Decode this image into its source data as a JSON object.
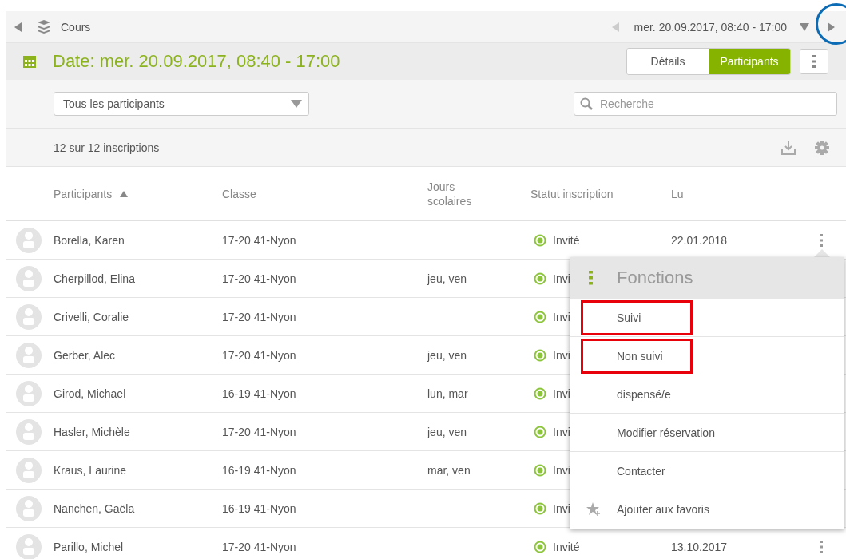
{
  "nav": {
    "breadcrumb": "Cours",
    "date": "mer. 20.09.2017, 08:40 - 17:00",
    "prev_disabled": true,
    "next_highlighted": true
  },
  "header": {
    "title": "Date: mer. 20.09.2017, 08:40 - 17:00",
    "tabs": [
      {
        "label": "Détails",
        "selected": false
      },
      {
        "label": "Participants",
        "selected": true
      }
    ]
  },
  "filter": {
    "value": "Tous les participants"
  },
  "search": {
    "placeholder": "Recherche"
  },
  "count": "12 sur 12 inscriptions",
  "columns": [
    {
      "label": "Participants",
      "sorted": true
    },
    {
      "label": "Classe",
      "sorted": false
    },
    {
      "label": "Jours scolaires",
      "sorted": false
    },
    {
      "label": "Statut inscription",
      "sorted": false
    },
    {
      "label": "Lu",
      "sorted": false
    }
  ],
  "rows": [
    {
      "name": "Borella, Karen",
      "classe": "17-20 41-Nyon",
      "status": "Invité",
      "lu": "22.01.2018"
    },
    {
      "name": "Cherpillod, Elina",
      "classe": "17-20 41-Nyon",
      "jours": "jeu, ven",
      "status": "Invi"
    },
    {
      "name": "Crivelli, Coralie",
      "classe": "17-20 41-Nyon",
      "status": "Invi"
    },
    {
      "name": "Gerber, Alec",
      "classe": "17-20 41-Nyon",
      "jours": "jeu, ven",
      "status": "Invi"
    },
    {
      "name": "Girod, Michael",
      "classe": "16-19 41-Nyon",
      "jours": "lun, mar",
      "status": "Invi"
    },
    {
      "name": "Hasler, Michèle",
      "classe": "17-20 41-Nyon",
      "jours": "jeu, ven",
      "status": "Invi"
    },
    {
      "name": "Kraus, Laurine",
      "classe": "16-19 41-Nyon",
      "jours": "mar, ven",
      "status": "Invi"
    },
    {
      "name": "Nanchen, Gaëla",
      "classe": "16-19 41-Nyon",
      "status": "Invi"
    },
    {
      "name": "Parillo, Michel",
      "classe": "17-20 41-Nyon",
      "status": "Invité",
      "lu": "13.10.2017"
    }
  ],
  "menu": {
    "title": "Fonctions",
    "items": [
      {
        "label": "Suivi",
        "kind": "plain",
        "highlighted": true
      },
      {
        "label": "Non suivi",
        "kind": "plain",
        "highlighted": true
      },
      {
        "label": "dispensé/e",
        "kind": "plain",
        "highlighted": false
      },
      {
        "label": "Modifier réservation",
        "kind": "plain",
        "highlighted": false
      },
      {
        "label": "Contacter",
        "kind": "plain",
        "highlighted": false
      },
      {
        "label": "Ajouter aux favoris",
        "kind": "favorite",
        "highlighted": false
      }
    ]
  }
}
